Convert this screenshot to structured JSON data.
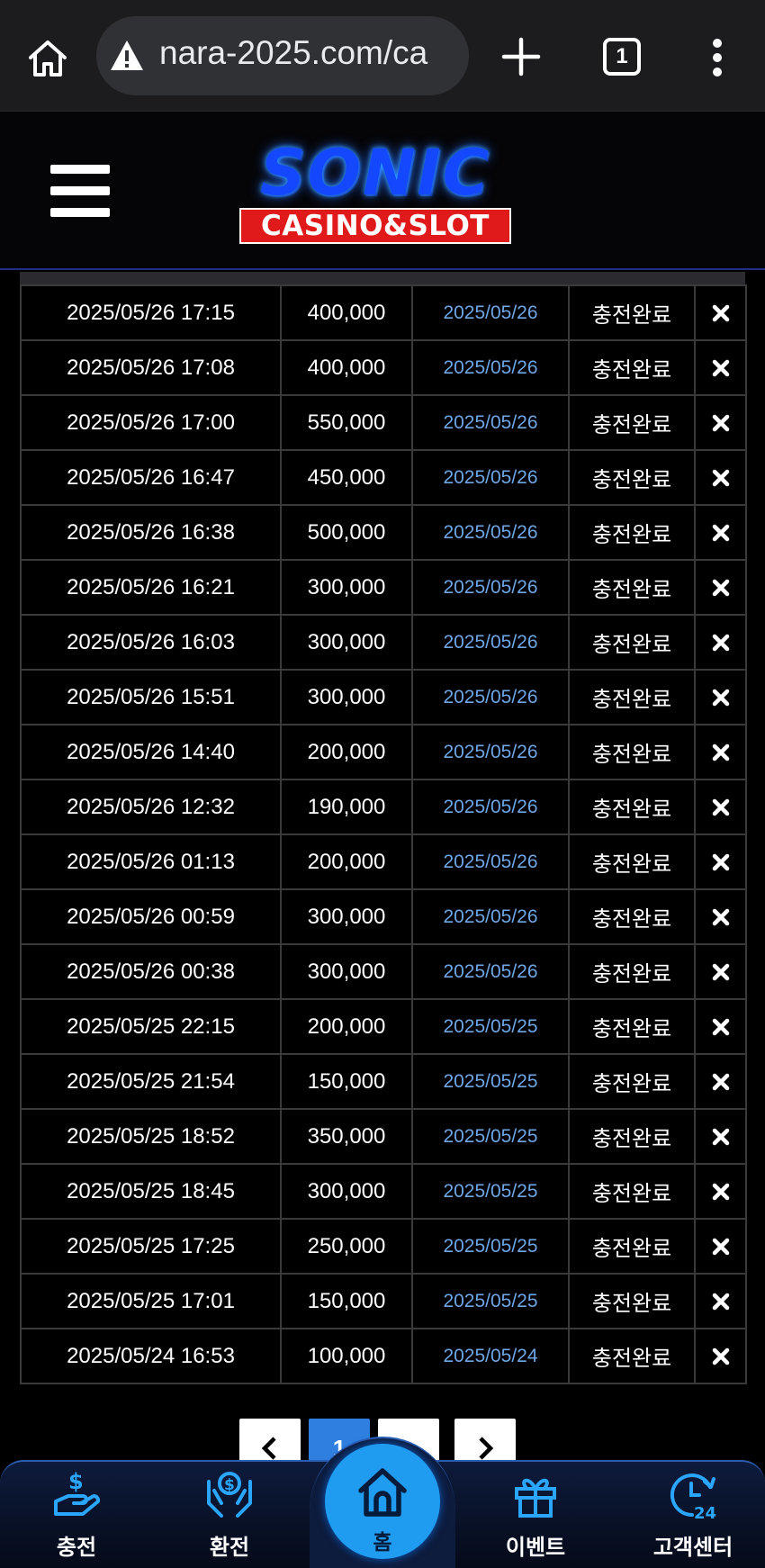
{
  "browser": {
    "url": "nara-2025.com/ca",
    "tab_count": "1"
  },
  "site": {
    "logo_title": "SONIC",
    "logo_subtitle": "CASINO&SLOT"
  },
  "table": {
    "rows": [
      {
        "date": "2025/05/26 17:15",
        "amount": "400,000",
        "processed": "2025/05/26",
        "status": "충전완료"
      },
      {
        "date": "2025/05/26 17:08",
        "amount": "400,000",
        "processed": "2025/05/26",
        "status": "충전완료"
      },
      {
        "date": "2025/05/26 17:00",
        "amount": "550,000",
        "processed": "2025/05/26",
        "status": "충전완료"
      },
      {
        "date": "2025/05/26 16:47",
        "amount": "450,000",
        "processed": "2025/05/26",
        "status": "충전완료"
      },
      {
        "date": "2025/05/26 16:38",
        "amount": "500,000",
        "processed": "2025/05/26",
        "status": "충전완료"
      },
      {
        "date": "2025/05/26 16:21",
        "amount": "300,000",
        "processed": "2025/05/26",
        "status": "충전완료"
      },
      {
        "date": "2025/05/26 16:03",
        "amount": "300,000",
        "processed": "2025/05/26",
        "status": "충전완료"
      },
      {
        "date": "2025/05/26 15:51",
        "amount": "300,000",
        "processed": "2025/05/26",
        "status": "충전완료"
      },
      {
        "date": "2025/05/26 14:40",
        "amount": "200,000",
        "processed": "2025/05/26",
        "status": "충전완료"
      },
      {
        "date": "2025/05/26 12:32",
        "amount": "190,000",
        "processed": "2025/05/26",
        "status": "충전완료"
      },
      {
        "date": "2025/05/26 01:13",
        "amount": "200,000",
        "processed": "2025/05/26",
        "status": "충전완료"
      },
      {
        "date": "2025/05/26 00:59",
        "amount": "300,000",
        "processed": "2025/05/26",
        "status": "충전완료"
      },
      {
        "date": "2025/05/26 00:38",
        "amount": "300,000",
        "processed": "2025/05/26",
        "status": "충전완료"
      },
      {
        "date": "2025/05/25 22:15",
        "amount": "200,000",
        "processed": "2025/05/25",
        "status": "충전완료"
      },
      {
        "date": "2025/05/25 21:54",
        "amount": "150,000",
        "processed": "2025/05/25",
        "status": "충전완료"
      },
      {
        "date": "2025/05/25 18:52",
        "amount": "350,000",
        "processed": "2025/05/25",
        "status": "충전완료"
      },
      {
        "date": "2025/05/25 18:45",
        "amount": "300,000",
        "processed": "2025/05/25",
        "status": "충전완료"
      },
      {
        "date": "2025/05/25 17:25",
        "amount": "250,000",
        "processed": "2025/05/25",
        "status": "충전완료"
      },
      {
        "date": "2025/05/25 17:01",
        "amount": "150,000",
        "processed": "2025/05/25",
        "status": "충전완료"
      },
      {
        "date": "2025/05/24 16:53",
        "amount": "100,000",
        "processed": "2025/05/24",
        "status": "충전완료"
      }
    ]
  },
  "pagination": {
    "current_page": "1"
  },
  "bottom_nav": {
    "charge": "충전",
    "exchange": "환전",
    "home": "홈",
    "event": "이벤트",
    "support": "고객센터"
  },
  "colors": {
    "accent": "#1f9bf0",
    "processed_date": "#6fa6e6",
    "logo_red": "#e0191b"
  }
}
